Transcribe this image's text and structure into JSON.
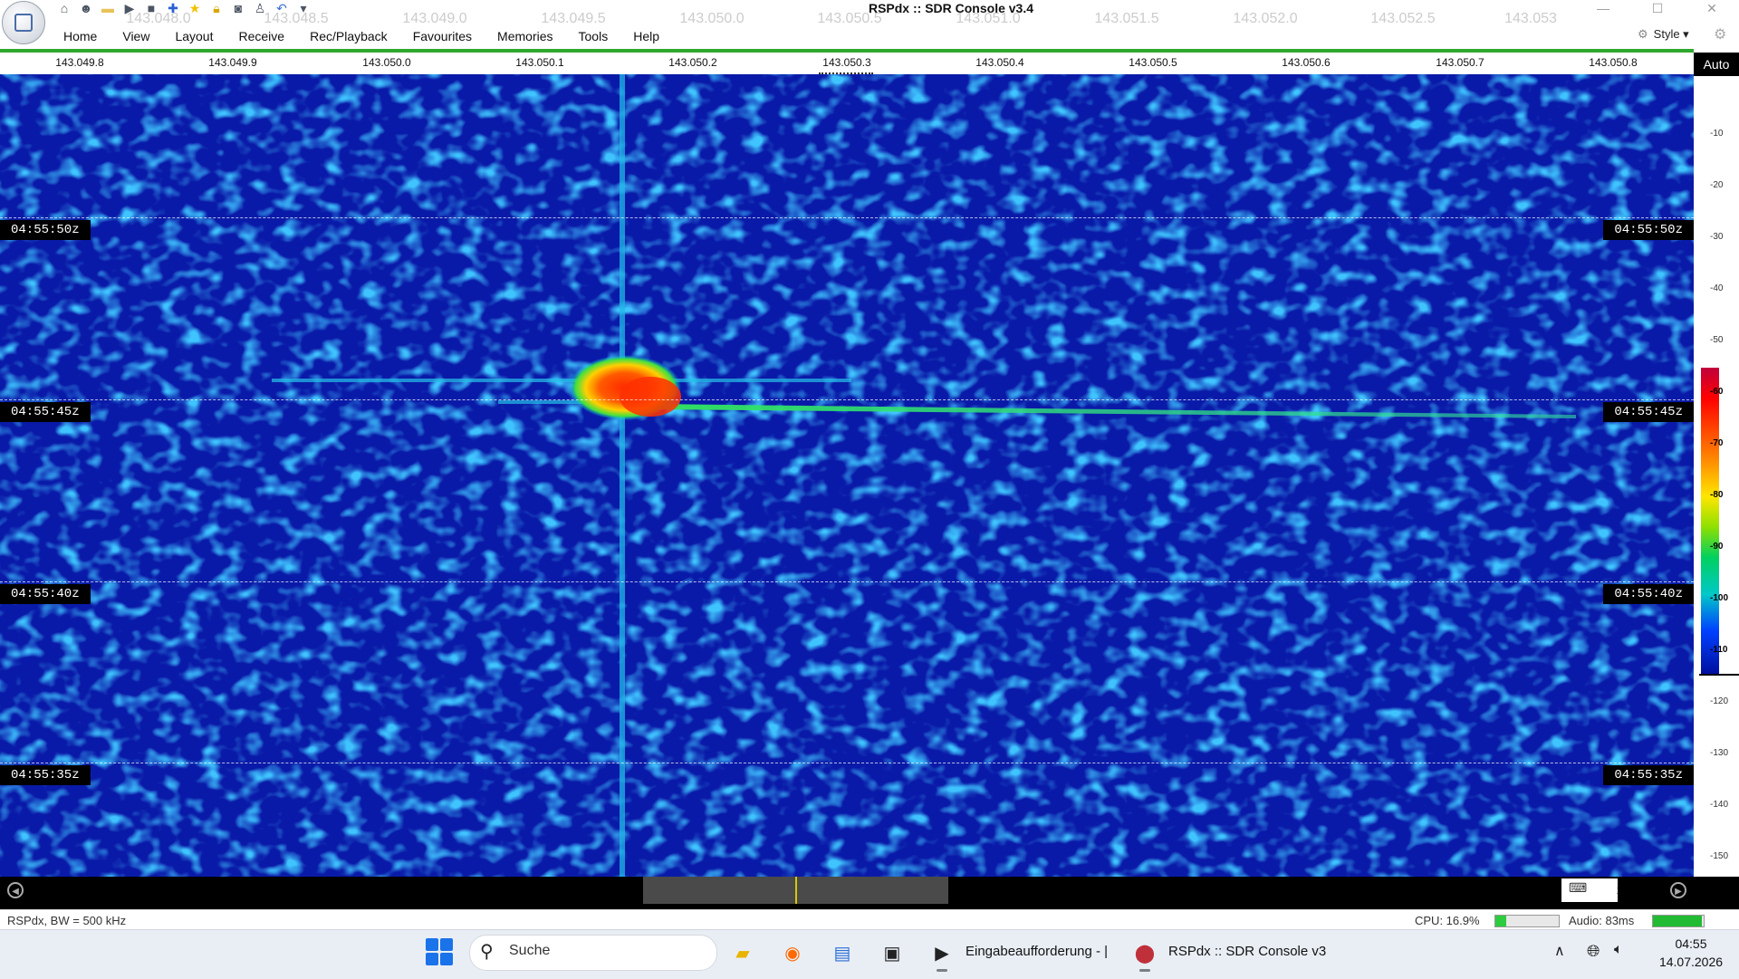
{
  "window": {
    "title": "RSPdx :: SDR Console v3.4"
  },
  "quick_access": [
    "home-icon",
    "users-icon",
    "folder-icon",
    "play-icon",
    "stop-icon",
    "plus-icon",
    "star-icon",
    "lock-icon",
    "camera-icon",
    "user-icon",
    "undo-icon",
    "dropdown-icon"
  ],
  "menu": {
    "items": [
      "Home",
      "View",
      "Layout",
      "Receive",
      "Rec/Playback",
      "Favourites",
      "Memories",
      "Tools",
      "Help"
    ],
    "style_label": "Style"
  },
  "top_scale": [
    "143.049.8",
    "143.049.9",
    "143.050.0",
    "143.050.1",
    "143.050.2",
    "143.050.3",
    "143.050.4",
    "143.050.5",
    "143.050.6",
    "143.050.7",
    "143.050.8"
  ],
  "waterfall": {
    "timestamps": [
      "04:55:50z",
      "04:55:45z",
      "04:55:40z",
      "04:55:35z"
    ]
  },
  "color_scale": {
    "auto_label": "Auto",
    "db_ticks": [
      "-10",
      "-20",
      "-30",
      "-40",
      "-50",
      "-60",
      "-70",
      "-80",
      "-90",
      "-100",
      "-110",
      "-120",
      "-130",
      "-140",
      "-150"
    ],
    "colors": {
      "high": "#ff0000",
      "mid": "#ffe600",
      "low": "#0010a0"
    }
  },
  "bottom_scale": {
    "ticks": [
      "143.048.0",
      "143.048.5",
      "143.049.0",
      "143.049.5",
      "143.050.0",
      "143.050.5",
      "143.051.0",
      "143.051.5",
      "143.052.0",
      "143.052.5",
      "143.053"
    ],
    "zoom": "x5"
  },
  "status": {
    "left": "RSPdx, BW = 500 kHz",
    "cpu": "CPU: 16.9%",
    "cpu_level": 0.169,
    "audio": "Audio: 83ms"
  },
  "taskbar": {
    "search_placeholder": "Suche",
    "apps": [
      {
        "name": "file-explorer-icon",
        "label": ""
      },
      {
        "name": "firefox-icon",
        "label": ""
      },
      {
        "name": "notepad-icon",
        "label": ""
      },
      {
        "name": "terminal-icon",
        "label": ""
      },
      {
        "name": "cmd-icon",
        "label": "Eingabeaufforderung - |"
      },
      {
        "name": "sdr-console-icon",
        "label": "RSPdx :: SDR Console v3"
      }
    ],
    "clock_time": "04:55",
    "clock_date": "14.07.2026"
  }
}
